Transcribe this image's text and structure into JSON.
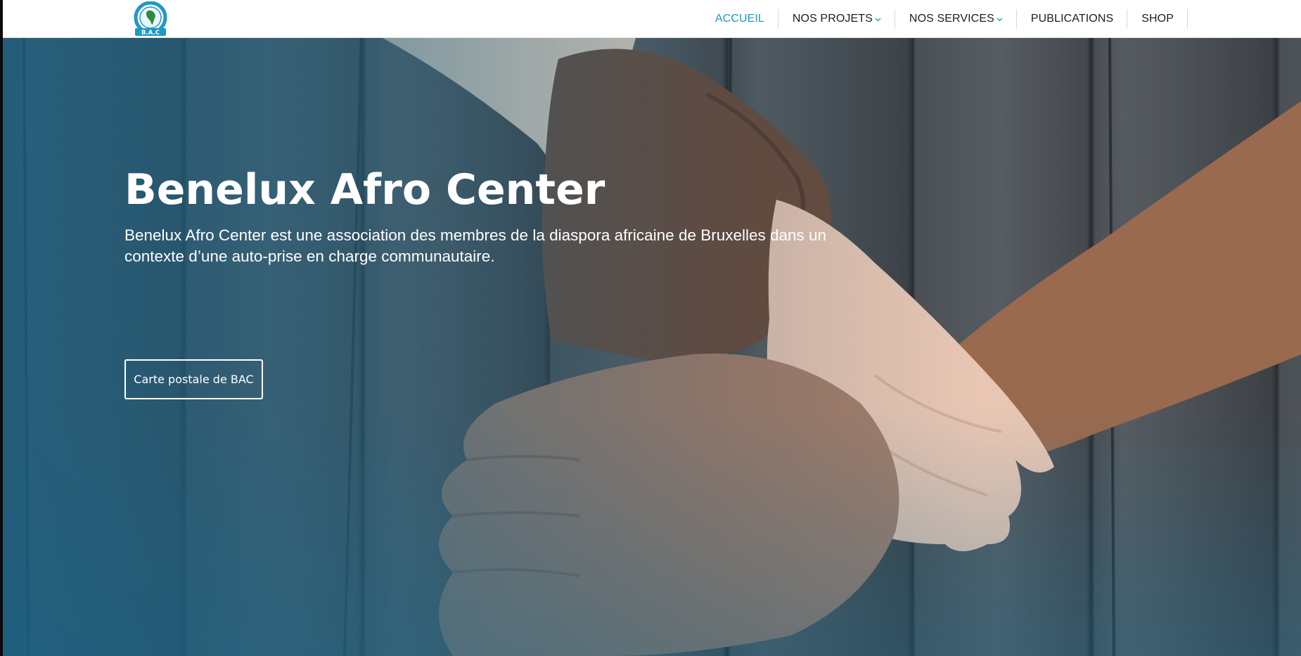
{
  "header": {
    "logo_text": "B.A.C",
    "nav": [
      {
        "label": "ACCUEIL",
        "active": true,
        "has_dropdown": false
      },
      {
        "label": "NOS PROJETS",
        "active": false,
        "has_dropdown": true
      },
      {
        "label": "NOS SERVICES",
        "active": false,
        "has_dropdown": true
      },
      {
        "label": "PUBLICATIONS",
        "active": false,
        "has_dropdown": false
      },
      {
        "label": "SHOP",
        "active": false,
        "has_dropdown": false
      }
    ]
  },
  "hero": {
    "title": "Benelux Afro Center",
    "description": "Benelux Afro Center est une association des membres de la diaspora africaine de Bruxelles dans un contexte d’une auto-prise en charge communautaire.",
    "button_label": "Carte postale de BAC"
  },
  "colors": {
    "accent": "#1f97c8",
    "nav_text": "#1d1d1d",
    "hero_text": "#ffffff"
  },
  "icons": [
    "logo-emblem",
    "chevron-down-icon"
  ]
}
